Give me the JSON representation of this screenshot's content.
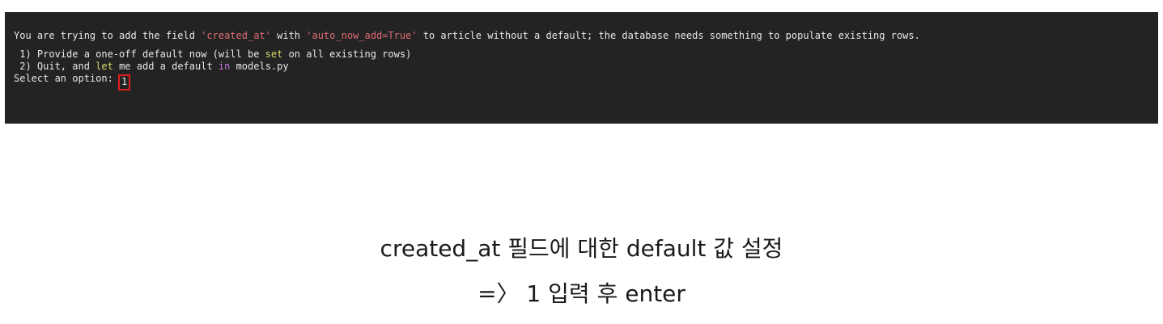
{
  "terminal": {
    "line1": {
      "part1": "You are trying to add the field ",
      "field": "'created_at'",
      "part2": " with ",
      "arg": "'auto_now_add=True'",
      "part3": " to article without a default; the database needs something to populate existing rows."
    },
    "line2": {
      "part1": " 1) Provide a one-off default now (will be ",
      "kw": "set",
      "part2": " on all existing rows)"
    },
    "line3": {
      "part1": " 2) Quit, and ",
      "kw1": "let",
      "part2": " me add a default ",
      "kw2": "in",
      "part3": " models.py"
    },
    "prompt": {
      "label": "Select an option: ",
      "input_value": "1"
    }
  },
  "caption": {
    "line1": "created_at 필드에 대한 default 값 설정",
    "line2": "=〉 1 입력 후 enter"
  },
  "colors": {
    "terminal_bg": "#232323",
    "string": "#e06c75",
    "keyword_yellow": "#d7d76a",
    "keyword_purple": "#c678dd",
    "highlight_box": "#e01e1e"
  }
}
